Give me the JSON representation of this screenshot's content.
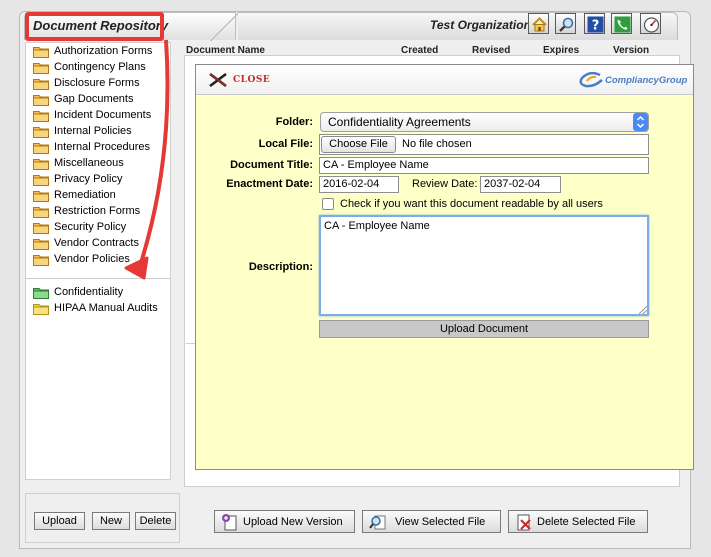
{
  "header": {
    "repository_title": "Document Repository",
    "organization": "Test Organization",
    "icons": [
      "home-icon",
      "search-icon",
      "help-icon",
      "phone-icon",
      "dashboard-icon"
    ]
  },
  "columns": {
    "document_name": "Document Name",
    "created": "Created",
    "revised": "Revised",
    "expires": "Expires",
    "version": "Version"
  },
  "folders": [
    {
      "label": "Authorization Forms",
      "color": "#e8a93b"
    },
    {
      "label": "Contingency Plans",
      "color": "#e8a93b"
    },
    {
      "label": "Disclosure Forms",
      "color": "#e8a93b"
    },
    {
      "label": "Gap Documents",
      "color": "#e8a93b"
    },
    {
      "label": "Incident Documents",
      "color": "#e8a93b"
    },
    {
      "label": "Internal Policies",
      "color": "#e8a93b"
    },
    {
      "label": "Internal Procedures",
      "color": "#e8a93b"
    },
    {
      "label": "Miscellaneous",
      "color": "#e8a93b"
    },
    {
      "label": "Privacy Policy",
      "color": "#e8a93b"
    },
    {
      "label": "Remediation",
      "color": "#e8a93b"
    },
    {
      "label": "Restriction Forms",
      "color": "#e8a93b"
    },
    {
      "label": "Security Policy",
      "color": "#e8a93b"
    },
    {
      "label": "Vendor Contracts",
      "color": "#e8a93b"
    },
    {
      "label": "Vendor Policies",
      "color": "#e8a93b"
    }
  ],
  "special_folders": [
    {
      "label": "Confidentiality",
      "color": "#4caf50"
    },
    {
      "label": "HIPAA Manual Audits",
      "color": "#e8c23b"
    }
  ],
  "left_buttons": {
    "upload": "Upload",
    "new": "New",
    "delete": "Delete"
  },
  "modal": {
    "close_label": "CLOSE",
    "logo_text": "CompliancyGroup",
    "folder_label": "Folder:",
    "folder_value": "Confidentiality Agreements",
    "local_file_label": "Local File:",
    "choose_file": "Choose File",
    "no_file": "No file chosen",
    "doc_title_label": "Document Title:",
    "doc_title_value": "CA - Employee Name",
    "enactment_label": "Enactment Date:",
    "enactment_value": "2016-02-04",
    "review_label": "Review Date:",
    "review_value": "2037-02-04",
    "readable_label": "Check if you want this document readable by all users",
    "description_label": "Description:",
    "description_value": "CA - Employee Name",
    "upload_document": "Upload Document"
  },
  "bottom_buttons": {
    "upload_new_version": "Upload New Version",
    "view_selected_file": "View Selected File",
    "delete_selected_file": "Delete Selected File"
  },
  "colors": {
    "annotation": "#e53935",
    "modal_bg": "#ffffc8",
    "accent_blue": "#4a8af4"
  }
}
